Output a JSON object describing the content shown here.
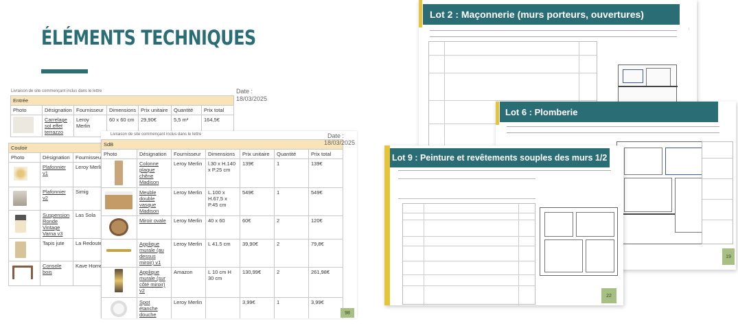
{
  "slide": {
    "title": "ÉLÉMENTS TECHNIQUES"
  },
  "doc1": {
    "meta": "Livraison de site commençant inclus dans le lettre",
    "date_label": "Date :",
    "date": "18/03/2025",
    "section": "Entrée",
    "headers": [
      "Photo",
      "Désignation",
      "Fournisseur",
      "Dimensions",
      "Prix unitaire",
      "Quantité",
      "Prix total"
    ],
    "rows": [
      {
        "designation": "Carrelage sol effet terrazzo",
        "fournisseur": "Leroy Merlin",
        "dimensions": "60 x 60 cm",
        "prix": "29,90€",
        "quantite": "5,5 m²",
        "total": "164,5€"
      }
    ]
  },
  "doc2": {
    "section": "Couloir",
    "headers": [
      "Photo",
      "Désignation",
      "Fournisseur"
    ],
    "rows": [
      {
        "designation": "Plafonnier v1",
        "fournisseur": "Leroy Merlin"
      },
      {
        "designation": "Plafonnier v2",
        "fournisseur": "Simig"
      },
      {
        "designation": "Suspension Ronde Vintage Varna v3",
        "fournisseur": "Las Sola"
      },
      {
        "designation": "Tapis jute",
        "fournisseur": "La Redoute"
      },
      {
        "designation": "Console bois",
        "fournisseur": "Kave Home"
      }
    ]
  },
  "doc3": {
    "meta": "Livraison de site commençant inclus dans le lettre",
    "date_label": "Date :",
    "date": "18/03/2025",
    "section": "SdB",
    "headers": [
      "Photo",
      "Désignation",
      "Fournisseur",
      "Dimensions",
      "Prix unitaire",
      "Quantité",
      "Prix total"
    ],
    "rows": [
      {
        "designation": "Colonne plaque chêne Madison",
        "fournisseur": "Leroy Merlin",
        "dimensions": "l.30 x H.140 x P.25 cm",
        "prix": "139€",
        "quantite": "1",
        "total": "139€"
      },
      {
        "designation": "Meuble double vasque Madison",
        "fournisseur": "Leroy Merlin",
        "dimensions": "L.100 x H.67,5 x P.45 cm",
        "prix": "549€",
        "quantite": "1",
        "total": "549€"
      },
      {
        "designation": "Miroir ovale",
        "fournisseur": "Leroy Merlin",
        "dimensions": "40 x 60",
        "prix": "60€",
        "quantite": "2",
        "total": "120€"
      },
      {
        "designation": "Applique murale (au dessus miroir) v1",
        "fournisseur": "Leroy Merlin",
        "dimensions": "L 41.5 cm",
        "prix": "39,90€",
        "quantite": "2",
        "total": "79,8€"
      },
      {
        "designation": "Applique murale (sur côté miroir) v2",
        "fournisseur": "Amazon",
        "dimensions": "L 10 cm H 30 cm",
        "prix": "130,99€",
        "quantite": "2",
        "total": "261,98€"
      },
      {
        "designation": "Spot étanche douche",
        "fournisseur": "Leroy Merlin",
        "dimensions": "",
        "prix": "3,99€",
        "quantite": "1",
        "total": "3,99€"
      }
    ],
    "page": "98"
  },
  "lot2": {
    "title": "Lot 2 : Maçonnerie (murs porteurs, ouvertures)"
  },
  "lot6": {
    "title": "Lot 6 : Plomberie",
    "page": "19"
  },
  "lot9": {
    "title": "Lot 9 : Peinture et revêtements souples des murs 1/2",
    "page": "22"
  }
}
